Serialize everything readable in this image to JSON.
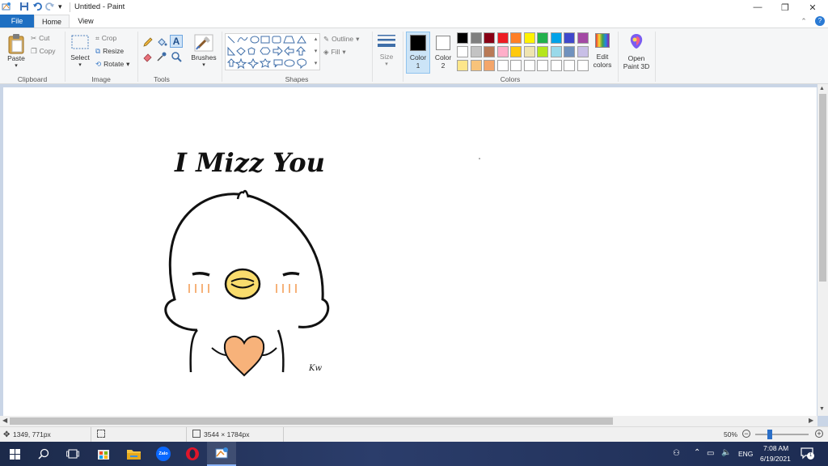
{
  "window": {
    "title": "Untitled - Paint",
    "min_glyph": "—",
    "restore_glyph": "❐",
    "close_glyph": "✕",
    "help_glyph": "?"
  },
  "tabs": {
    "file": "File",
    "home": "Home",
    "view": "View"
  },
  "ribbon": {
    "clipboard": {
      "paste": "Paste",
      "cut": "Cut",
      "copy": "Copy",
      "label": "Clipboard"
    },
    "image": {
      "select": "Select",
      "crop": "Crop",
      "resize": "Resize",
      "rotate": "Rotate",
      "label": "Image"
    },
    "tools": {
      "label": "Tools",
      "text_tool": "A"
    },
    "brushes": {
      "label": "Brushes"
    },
    "shapes": {
      "outline": "Outline",
      "fill": "Fill",
      "label": "Shapes"
    },
    "size": {
      "label": "Size"
    },
    "color1": {
      "label": "Color",
      "sub": "1"
    },
    "color2": {
      "label": "Color",
      "sub": "2"
    },
    "edit_colors": {
      "line1": "Edit",
      "line2": "colors"
    },
    "paint3d": {
      "line1": "Open",
      "line2": "Paint 3D"
    },
    "colors_label": "Colors",
    "palette_row1": [
      "#000000",
      "#7f7f7f",
      "#880015",
      "#ed1c24",
      "#ff7f27",
      "#fff200",
      "#22b14c",
      "#00a2e8",
      "#3f48cc",
      "#a349a4"
    ],
    "palette_row2": [
      "#ffffff",
      "#c3c3c3",
      "#b97a57",
      "#ffaec9",
      "#ffc90e",
      "#efe4b0",
      "#b5e61d",
      "#99d9ea",
      "#7092be",
      "#c8bfe7"
    ],
    "palette_row3": [
      "#fde68a",
      "#f8c37a",
      "#f4a66a",
      "#ffffff",
      "#ffffff",
      "#ffffff",
      "#ffffff",
      "#ffffff",
      "#ffffff",
      "#ffffff"
    ]
  },
  "drawing": {
    "text": "I Mizz You",
    "signature": "Kw",
    "heart_color": "#f7b27a",
    "beak_color": "#f9dc6d",
    "blush_color": "#f6b27a"
  },
  "status": {
    "cursor_pos": "1349, 771px",
    "canvas_size": "3544 × 1784px",
    "zoom": "50%"
  },
  "taskbar": {
    "language": "ENG",
    "time": "7:08 AM",
    "date": "6/19/2021",
    "zalo_label": "Zalo",
    "notification_count": "1"
  }
}
